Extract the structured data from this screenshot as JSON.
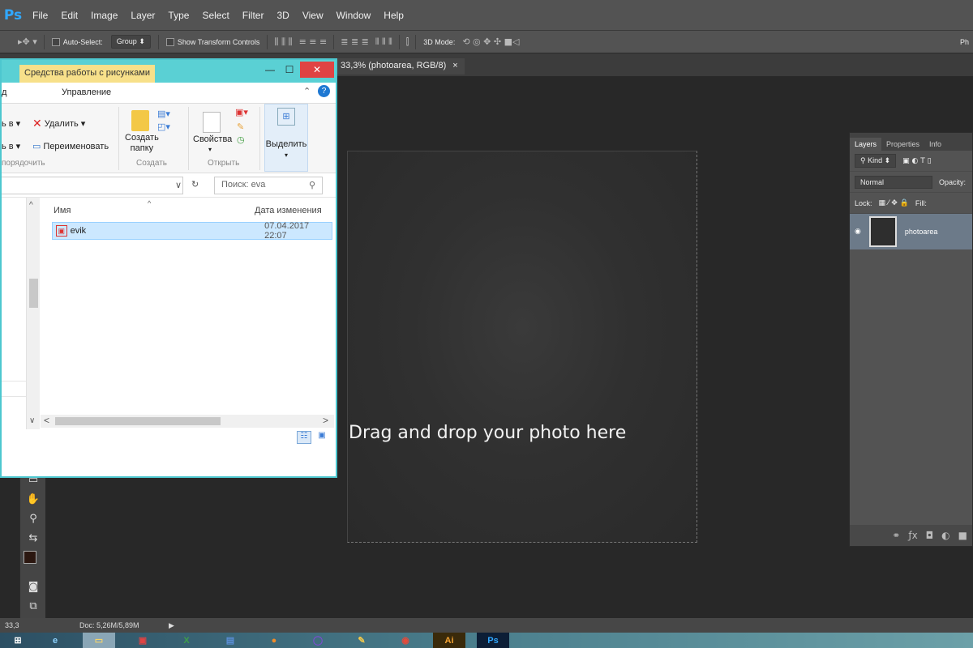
{
  "photoshop": {
    "logo": "Ps",
    "menu": [
      "File",
      "Edit",
      "Image",
      "Layer",
      "Type",
      "Select",
      "Filter",
      "3D",
      "View",
      "Window",
      "Help"
    ],
    "options": {
      "auto_select": "Auto-Select:",
      "group": "Group",
      "transform_controls": "Show Transform Controls",
      "mode_3d": "3D Mode:",
      "right_label": "Ph"
    },
    "doc_tab": "33,3% (photoarea, RGB/8)",
    "doc_tab_close": "×",
    "canvas_text": "Drag and drop your photo here",
    "layers": {
      "tabs": [
        "Layers",
        "Properties",
        "Info"
      ],
      "kind": "Kind",
      "blend_mode": "Normal",
      "opacity_label": "Opacity:",
      "lock_label": "Lock:",
      "fill_label": "Fill:",
      "layer_name": "photoarea"
    },
    "status": {
      "zoom": "33,3",
      "doc": "Doc: 5,26M/5,89M"
    }
  },
  "explorer": {
    "context_label": "Средства работы с рисунками",
    "tab_left": "д",
    "tab_manage": "Управление",
    "ribbon": {
      "move_to": "ь в",
      "copy_to": "ь в",
      "delete": "Удалить",
      "rename": "Переименовать",
      "organize_group": "порядочить",
      "new_folder_line1": "Создать",
      "new_folder_line2": "папку",
      "create_group": "Создать",
      "properties": "Свойства",
      "open_group": "Открыть",
      "select": "Выделить"
    },
    "search_placeholder": "Поиск: eva",
    "columns": {
      "name": "Имя",
      "date": "Дата изменения"
    },
    "files": [
      {
        "name": "evik",
        "date": "07.04.2017 22:07"
      }
    ]
  },
  "colors": {
    "ps_ui": "#535353",
    "canvas_bg": "#282828",
    "explorer_accent": "#5ad0d4",
    "close_red": "#e04343",
    "selection": "#cce8ff"
  }
}
